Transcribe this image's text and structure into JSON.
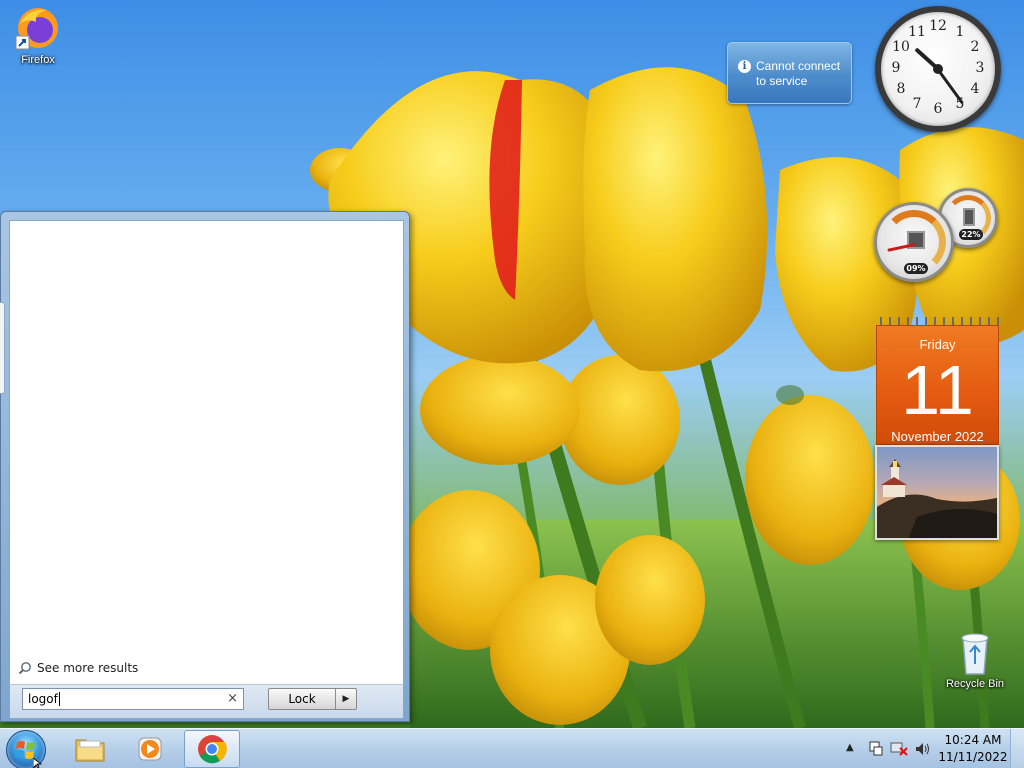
{
  "desktop": {
    "icons": [
      {
        "label": "Firefox"
      },
      {
        "label": "Recycle Bin"
      }
    ]
  },
  "gadgets": {
    "weather": {
      "message": "Cannot connect to service"
    },
    "clock": {
      "numbers": [
        "12",
        "1",
        "2",
        "3",
        "4",
        "5",
        "6",
        "7",
        "8",
        "9",
        "10",
        "11"
      ],
      "time": "10:24"
    },
    "cpu_meter": {
      "cpu_percent": "09%",
      "memory_percent": "22%"
    },
    "calendar": {
      "day_of_week": "Friday",
      "day": "11",
      "month_year": "November 2022",
      "color": "#e35a10"
    }
  },
  "start_menu": {
    "see_more_label": "See more results",
    "search_value": "logof",
    "lock_label": "Lock"
  },
  "taskbar": {
    "pinned": [
      "start-button",
      "windows-explorer",
      "windows-media-player",
      "google-chrome"
    ],
    "clock_time": "10:24 AM",
    "clock_date": "11/11/2022",
    "accent": "#b9d1ea"
  }
}
